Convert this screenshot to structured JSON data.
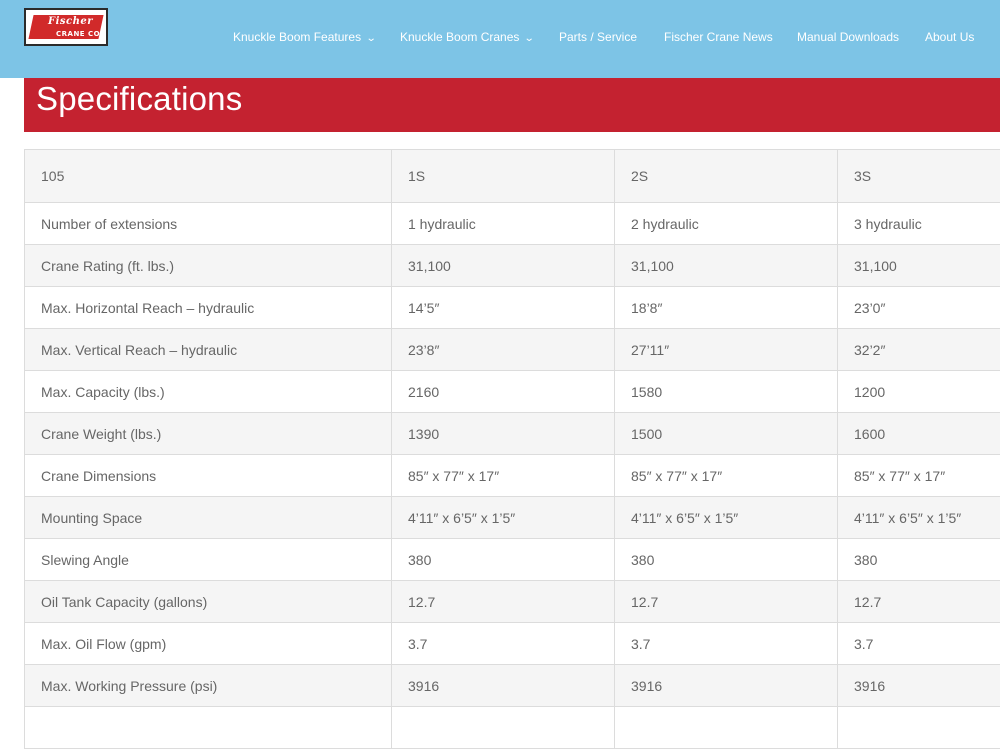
{
  "logo": {
    "top_text": "Fischer",
    "bottom_text": "CRANE CO."
  },
  "nav": [
    {
      "label": "Knuckle Boom Features",
      "has_dropdown": true
    },
    {
      "label": "Knuckle Boom Cranes",
      "has_dropdown": true
    },
    {
      "label": "Parts / Service",
      "has_dropdown": false
    },
    {
      "label": "Fischer Crane News",
      "has_dropdown": false
    },
    {
      "label": "Manual Downloads",
      "has_dropdown": false
    },
    {
      "label": "About Us",
      "has_dropdown": false
    }
  ],
  "chevron_glyph": "⌄",
  "colors": {
    "header": "#7dc4e6",
    "banner": "#c42230",
    "logo_red": "#d12a2a"
  },
  "banner": {
    "title": "Specifications"
  },
  "specs": {
    "header": [
      "105",
      "1S",
      "2S",
      "3S"
    ],
    "rows": [
      [
        "Number of extensions",
        "1 hydraulic",
        "2 hydraulic",
        "3 hydraulic"
      ],
      [
        "Crane Rating (ft. lbs.)",
        "31,100",
        "31,100",
        "31,100"
      ],
      [
        "Max. Horizontal Reach – hydraulic",
        "14’5″",
        "18’8″",
        "23’0″"
      ],
      [
        "Max. Vertical Reach – hydraulic",
        "23’8″",
        "27’11″",
        "32’2″"
      ],
      [
        "Max. Capacity (lbs.)",
        "2160",
        "1580",
        "1200"
      ],
      [
        "Crane Weight (lbs.)",
        "1390",
        "1500",
        "1600"
      ],
      [
        "Crane Dimensions",
        "85″ x 77″ x 17″",
        "85″ x 77″ x 17″",
        "85″ x 77″ x 17″"
      ],
      [
        "Mounting Space",
        "4’11″ x 6’5″ x 1’5″",
        "4’11″ x 6’5″ x 1’5″",
        "4’11″ x 6’5″ x 1’5″"
      ],
      [
        "Slewing Angle",
        "380",
        "380",
        "380"
      ],
      [
        "Oil Tank Capacity (gallons)",
        "12.7",
        "12.7",
        "12.7"
      ],
      [
        "Max. Oil Flow (gpm)",
        "3.7",
        "3.7",
        "3.7"
      ],
      [
        "Max. Working Pressure (psi)",
        "3916",
        "3916",
        "3916"
      ]
    ]
  }
}
